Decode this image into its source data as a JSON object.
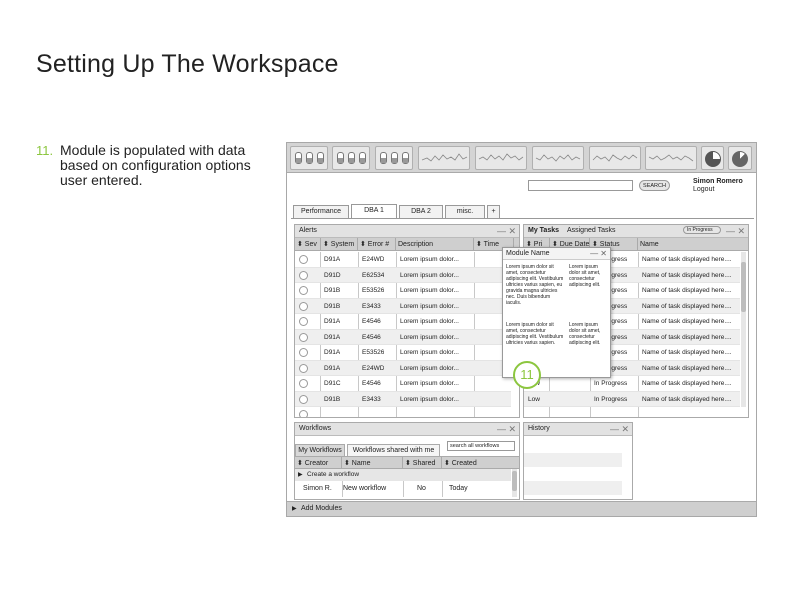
{
  "page": {
    "title": "Setting Up The Workspace",
    "annotation_number": "11.",
    "annotation_text": "Module is populated with data based on configuration options user entered."
  },
  "header": {
    "search_button": "SEARCH",
    "user_name": "Simon Romero",
    "logout": "Logout"
  },
  "tabs": [
    "Performance",
    "DBA 1",
    "DBA 2",
    "misc.",
    "+"
  ],
  "alerts": {
    "title": "Alerts",
    "columns": [
      "⬍ Sev",
      "⬍ System",
      "⬍ Error #",
      "Description",
      "⬍ Time"
    ],
    "rows": [
      {
        "system": "D91A",
        "error": "E24WD",
        "description": "Lorem ipsum dolor..."
      },
      {
        "system": "D91D",
        "error": "E62534",
        "description": "Lorem ipsum dolor..."
      },
      {
        "system": "D91B",
        "error": "E53526",
        "description": "Lorem ipsum dolor..."
      },
      {
        "system": "D91B",
        "error": "E3433",
        "description": "Lorem ipsum dolor..."
      },
      {
        "system": "D91A",
        "error": "E4546",
        "description": "Lorem ipsum dolor..."
      },
      {
        "system": "D91A",
        "error": "E4546",
        "description": "Lorem ipsum dolor..."
      },
      {
        "system": "D91A",
        "error": "E53526",
        "description": "Lorem ipsum dolor..."
      },
      {
        "system": "D91A",
        "error": "E24WD",
        "description": "Lorem ipsum dolor..."
      },
      {
        "system": "D91C",
        "error": "E4546",
        "description": "Lorem ipsum dolor..."
      },
      {
        "system": "D91B",
        "error": "E3433",
        "description": "Lorem ipsum dolor..."
      }
    ]
  },
  "tasks": {
    "title": "My Tasks",
    "subtitle": "Assigned Tasks",
    "status_filter": "In Progress",
    "columns": [
      "⬍ Pri",
      "⬍ Due Date",
      "⬍ Status",
      "Name"
    ],
    "rows": [
      {
        "priority": "",
        "status": "In Progress",
        "name": "Name of task displayed here...."
      },
      {
        "priority": "",
        "status": "In Progress",
        "name": "Name of task displayed here...."
      },
      {
        "priority": "",
        "status": "In Progress",
        "name": "Name of task displayed here...."
      },
      {
        "priority": "",
        "status": "In Progress",
        "name": "Name of task displayed here...."
      },
      {
        "priority": "",
        "status": "In Progress",
        "name": "Name of task displayed here...."
      },
      {
        "priority": "",
        "status": "In Progress",
        "name": "Name of task displayed here...."
      },
      {
        "priority": "",
        "status": "In Progress",
        "name": "Name of task displayed here...."
      },
      {
        "priority": "",
        "status": "In Progress",
        "name": "Name of task displayed here...."
      },
      {
        "priority": "Low",
        "status": "In Progress",
        "name": "Name of task displayed here...."
      },
      {
        "priority": "Low",
        "status": "In Progress",
        "name": "Name of task displayed here...."
      }
    ]
  },
  "popup": {
    "title": "Module Name",
    "col1_para1": "Lorem ipsum dolor sit amet, consectetur adipiscing elit. Vestibulum ultricies varius sapien, eu gravida magna ultricies nec. Duis bibendum iaculis.",
    "col2_para1": "Lorem ipsum dolor sit amet, consectetur adipiscing elit.",
    "col1_para2": "Lorem ipsum dolor sit amet, consectetur adipiscing elit. Vestibulum ultricies varius sapien.",
    "col2_para2": "Lorem ipsum dolor sit amet, consectetur adipiscing elit.",
    "badge": "11"
  },
  "workflows": {
    "title": "Workflows",
    "tab_mine": "My Workflows",
    "tab_shared": "Workflows shared with me",
    "search_placeholder": "search all workflows",
    "columns": [
      "⬍ Creator",
      "⬍ Name",
      "⬍ Shared",
      "⬍ Created"
    ],
    "create": "Create a workflow",
    "rows": [
      {
        "creator": "Simon R.",
        "name": "New workflow",
        "shared": "No",
        "created": "Today"
      }
    ]
  },
  "history": {
    "title": "History"
  },
  "footer": {
    "add_modules": "Add Modules"
  },
  "colors": {
    "accent": "#8cc63f"
  }
}
